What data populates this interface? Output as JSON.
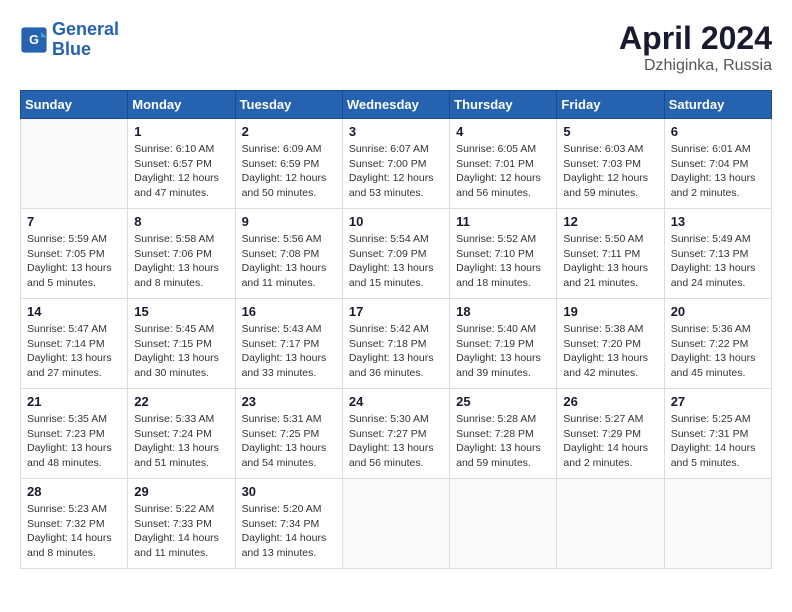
{
  "logo": {
    "line1": "General",
    "line2": "Blue"
  },
  "title": "April 2024",
  "subtitle": "Dzhiginka, Russia",
  "days_header": [
    "Sunday",
    "Monday",
    "Tuesday",
    "Wednesday",
    "Thursday",
    "Friday",
    "Saturday"
  ],
  "weeks": [
    [
      {
        "day": "",
        "empty": true
      },
      {
        "day": "1",
        "sunrise": "Sunrise: 6:10 AM",
        "sunset": "Sunset: 6:57 PM",
        "daylight": "Daylight: 12 hours and 47 minutes."
      },
      {
        "day": "2",
        "sunrise": "Sunrise: 6:09 AM",
        "sunset": "Sunset: 6:59 PM",
        "daylight": "Daylight: 12 hours and 50 minutes."
      },
      {
        "day": "3",
        "sunrise": "Sunrise: 6:07 AM",
        "sunset": "Sunset: 7:00 PM",
        "daylight": "Daylight: 12 hours and 53 minutes."
      },
      {
        "day": "4",
        "sunrise": "Sunrise: 6:05 AM",
        "sunset": "Sunset: 7:01 PM",
        "daylight": "Daylight: 12 hours and 56 minutes."
      },
      {
        "day": "5",
        "sunrise": "Sunrise: 6:03 AM",
        "sunset": "Sunset: 7:03 PM",
        "daylight": "Daylight: 12 hours and 59 minutes."
      },
      {
        "day": "6",
        "sunrise": "Sunrise: 6:01 AM",
        "sunset": "Sunset: 7:04 PM",
        "daylight": "Daylight: 13 hours and 2 minutes."
      }
    ],
    [
      {
        "day": "7",
        "sunrise": "Sunrise: 5:59 AM",
        "sunset": "Sunset: 7:05 PM",
        "daylight": "Daylight: 13 hours and 5 minutes."
      },
      {
        "day": "8",
        "sunrise": "Sunrise: 5:58 AM",
        "sunset": "Sunset: 7:06 PM",
        "daylight": "Daylight: 13 hours and 8 minutes."
      },
      {
        "day": "9",
        "sunrise": "Sunrise: 5:56 AM",
        "sunset": "Sunset: 7:08 PM",
        "daylight": "Daylight: 13 hours and 11 minutes."
      },
      {
        "day": "10",
        "sunrise": "Sunrise: 5:54 AM",
        "sunset": "Sunset: 7:09 PM",
        "daylight": "Daylight: 13 hours and 15 minutes."
      },
      {
        "day": "11",
        "sunrise": "Sunrise: 5:52 AM",
        "sunset": "Sunset: 7:10 PM",
        "daylight": "Daylight: 13 hours and 18 minutes."
      },
      {
        "day": "12",
        "sunrise": "Sunrise: 5:50 AM",
        "sunset": "Sunset: 7:11 PM",
        "daylight": "Daylight: 13 hours and 21 minutes."
      },
      {
        "day": "13",
        "sunrise": "Sunrise: 5:49 AM",
        "sunset": "Sunset: 7:13 PM",
        "daylight": "Daylight: 13 hours and 24 minutes."
      }
    ],
    [
      {
        "day": "14",
        "sunrise": "Sunrise: 5:47 AM",
        "sunset": "Sunset: 7:14 PM",
        "daylight": "Daylight: 13 hours and 27 minutes."
      },
      {
        "day": "15",
        "sunrise": "Sunrise: 5:45 AM",
        "sunset": "Sunset: 7:15 PM",
        "daylight": "Daylight: 13 hours and 30 minutes."
      },
      {
        "day": "16",
        "sunrise": "Sunrise: 5:43 AM",
        "sunset": "Sunset: 7:17 PM",
        "daylight": "Daylight: 13 hours and 33 minutes."
      },
      {
        "day": "17",
        "sunrise": "Sunrise: 5:42 AM",
        "sunset": "Sunset: 7:18 PM",
        "daylight": "Daylight: 13 hours and 36 minutes."
      },
      {
        "day": "18",
        "sunrise": "Sunrise: 5:40 AM",
        "sunset": "Sunset: 7:19 PM",
        "daylight": "Daylight: 13 hours and 39 minutes."
      },
      {
        "day": "19",
        "sunrise": "Sunrise: 5:38 AM",
        "sunset": "Sunset: 7:20 PM",
        "daylight": "Daylight: 13 hours and 42 minutes."
      },
      {
        "day": "20",
        "sunrise": "Sunrise: 5:36 AM",
        "sunset": "Sunset: 7:22 PM",
        "daylight": "Daylight: 13 hours and 45 minutes."
      }
    ],
    [
      {
        "day": "21",
        "sunrise": "Sunrise: 5:35 AM",
        "sunset": "Sunset: 7:23 PM",
        "daylight": "Daylight: 13 hours and 48 minutes."
      },
      {
        "day": "22",
        "sunrise": "Sunrise: 5:33 AM",
        "sunset": "Sunset: 7:24 PM",
        "daylight": "Daylight: 13 hours and 51 minutes."
      },
      {
        "day": "23",
        "sunrise": "Sunrise: 5:31 AM",
        "sunset": "Sunset: 7:25 PM",
        "daylight": "Daylight: 13 hours and 54 minutes."
      },
      {
        "day": "24",
        "sunrise": "Sunrise: 5:30 AM",
        "sunset": "Sunset: 7:27 PM",
        "daylight": "Daylight: 13 hours and 56 minutes."
      },
      {
        "day": "25",
        "sunrise": "Sunrise: 5:28 AM",
        "sunset": "Sunset: 7:28 PM",
        "daylight": "Daylight: 13 hours and 59 minutes."
      },
      {
        "day": "26",
        "sunrise": "Sunrise: 5:27 AM",
        "sunset": "Sunset: 7:29 PM",
        "daylight": "Daylight: 14 hours and 2 minutes."
      },
      {
        "day": "27",
        "sunrise": "Sunrise: 5:25 AM",
        "sunset": "Sunset: 7:31 PM",
        "daylight": "Daylight: 14 hours and 5 minutes."
      }
    ],
    [
      {
        "day": "28",
        "sunrise": "Sunrise: 5:23 AM",
        "sunset": "Sunset: 7:32 PM",
        "daylight": "Daylight: 14 hours and 8 minutes."
      },
      {
        "day": "29",
        "sunrise": "Sunrise: 5:22 AM",
        "sunset": "Sunset: 7:33 PM",
        "daylight": "Daylight: 14 hours and 11 minutes."
      },
      {
        "day": "30",
        "sunrise": "Sunrise: 5:20 AM",
        "sunset": "Sunset: 7:34 PM",
        "daylight": "Daylight: 14 hours and 13 minutes."
      },
      {
        "day": "",
        "empty": true
      },
      {
        "day": "",
        "empty": true
      },
      {
        "day": "",
        "empty": true
      },
      {
        "day": "",
        "empty": true
      }
    ]
  ]
}
